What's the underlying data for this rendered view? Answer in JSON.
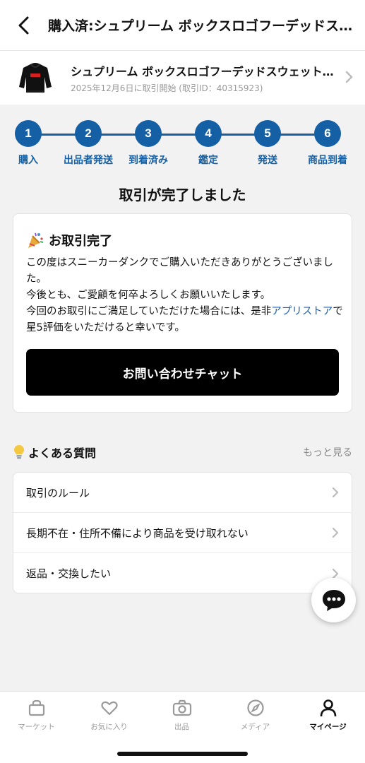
{
  "header": {
    "title": "購入済:シュプリーム ボックスロゴフーデッドスウェットシャツ",
    "back_icon": "chevron-left-icon"
  },
  "product": {
    "name": "シュプリーム ボックスロゴフーデッドスウェットシャツ",
    "meta": "2025年12月6日に取引開始 (取引ID：40315923)"
  },
  "steps": [
    {
      "num": "1",
      "label": "購入"
    },
    {
      "num": "2",
      "label": "出品者発送"
    },
    {
      "num": "3",
      "label": "到着済み"
    },
    {
      "num": "4",
      "label": "鑑定"
    },
    {
      "num": "5",
      "label": "発送"
    },
    {
      "num": "6",
      "label": "商品到着"
    }
  ],
  "status_title": "取引が完了しました",
  "completion_card": {
    "title": "お取引完了",
    "icon": "party-popper-icon",
    "line1": "この度はスニーカーダンクでご購入いただきありがとうございました。",
    "line2": "今後とも、ご愛顧を何卒よろしくお願いいたします。",
    "line3_before": "今回のお取引にご満足していただけた場合には、是非",
    "line3_link": "アプリストア",
    "line3_after": "で星5評価をいただけると幸いです。",
    "chat_button": "お問い合わせチャット"
  },
  "faq": {
    "title": "よくある質問",
    "more": "もっと見る",
    "items": [
      "取引のルール",
      "長期不在・住所不備により商品を受け取れない",
      "返品・交換したい"
    ]
  },
  "tabbar": [
    {
      "label": "マーケット",
      "icon": "bag-icon"
    },
    {
      "label": "お気に入り",
      "icon": "heart-icon"
    },
    {
      "label": "出品",
      "icon": "camera-icon"
    },
    {
      "label": "メディア",
      "icon": "compass-icon"
    },
    {
      "label": "マイページ",
      "icon": "person-icon",
      "active": true
    }
  ],
  "colors": {
    "accent": "#1560a5",
    "link": "#1f5fa8",
    "button": "#000000",
    "background": "#f2f2f2"
  }
}
